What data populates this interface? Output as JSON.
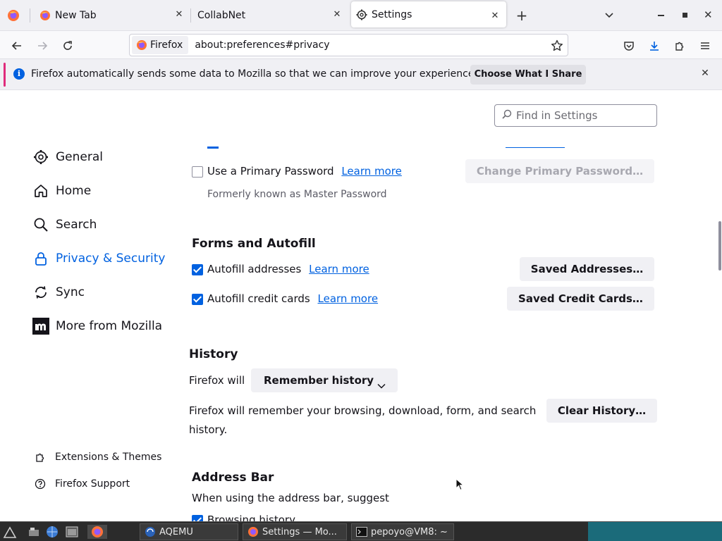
{
  "tabs": [
    {
      "label": "New Tab",
      "icon": "firefox-icon"
    },
    {
      "label": "CollabNet",
      "icon": ""
    },
    {
      "label": "Settings",
      "icon": "gear-icon",
      "selected": true
    }
  ],
  "navbar": {
    "identity_label": "Firefox",
    "url": "about:preferences#privacy"
  },
  "notification": {
    "text": "Firefox automatically sends some data to Mozilla so that we can improve your experience.",
    "button_label": "Choose What I Share"
  },
  "settings": {
    "search_placeholder": "Find in Settings",
    "nav": [
      {
        "label": "General",
        "icon": "gear-icon"
      },
      {
        "label": "Home",
        "icon": "home-icon"
      },
      {
        "label": "Search",
        "icon": "search-icon"
      },
      {
        "label": "Privacy & Security",
        "icon": "lock-icon",
        "selected": true
      },
      {
        "label": "Sync",
        "icon": "sync-icon"
      },
      {
        "label": "More from Mozilla",
        "icon": "mozilla-icon"
      }
    ],
    "nav_footer": [
      {
        "label": "Extensions & Themes",
        "icon": "puzzle-icon"
      },
      {
        "label": "Firefox Support",
        "icon": "help-icon"
      }
    ],
    "primary_password": {
      "label": "Use a Primary Password",
      "learn_more": "Learn more",
      "checked": false,
      "button": "Change Primary Password…",
      "note": "Formerly known as Master Password"
    },
    "forms": {
      "heading": "Forms and Autofill",
      "addresses_label": "Autofill addresses",
      "addresses_learn": "Learn more",
      "addresses_button": "Saved Addresses…",
      "cards_label": "Autofill credit cards",
      "cards_learn": "Learn more",
      "cards_button": "Saved Credit Cards…"
    },
    "history": {
      "heading": "History",
      "will_label": "Firefox will",
      "dropdown_value": "Remember history",
      "description": "Firefox will remember your browsing, download, form, and search history.",
      "clear_button": "Clear History…"
    },
    "address_bar": {
      "heading": "Address Bar",
      "description": "When using the address bar, suggest",
      "browsing_history": "Browsing history"
    }
  },
  "taskbar": {
    "tasks": [
      {
        "label": "AQEMU"
      },
      {
        "label": "Settings — Mo..."
      },
      {
        "label": "pepoyo@VM8: ~"
      }
    ]
  },
  "colors": {
    "accent": "#0061e0",
    "notification_stripe": "#e02b7c"
  }
}
